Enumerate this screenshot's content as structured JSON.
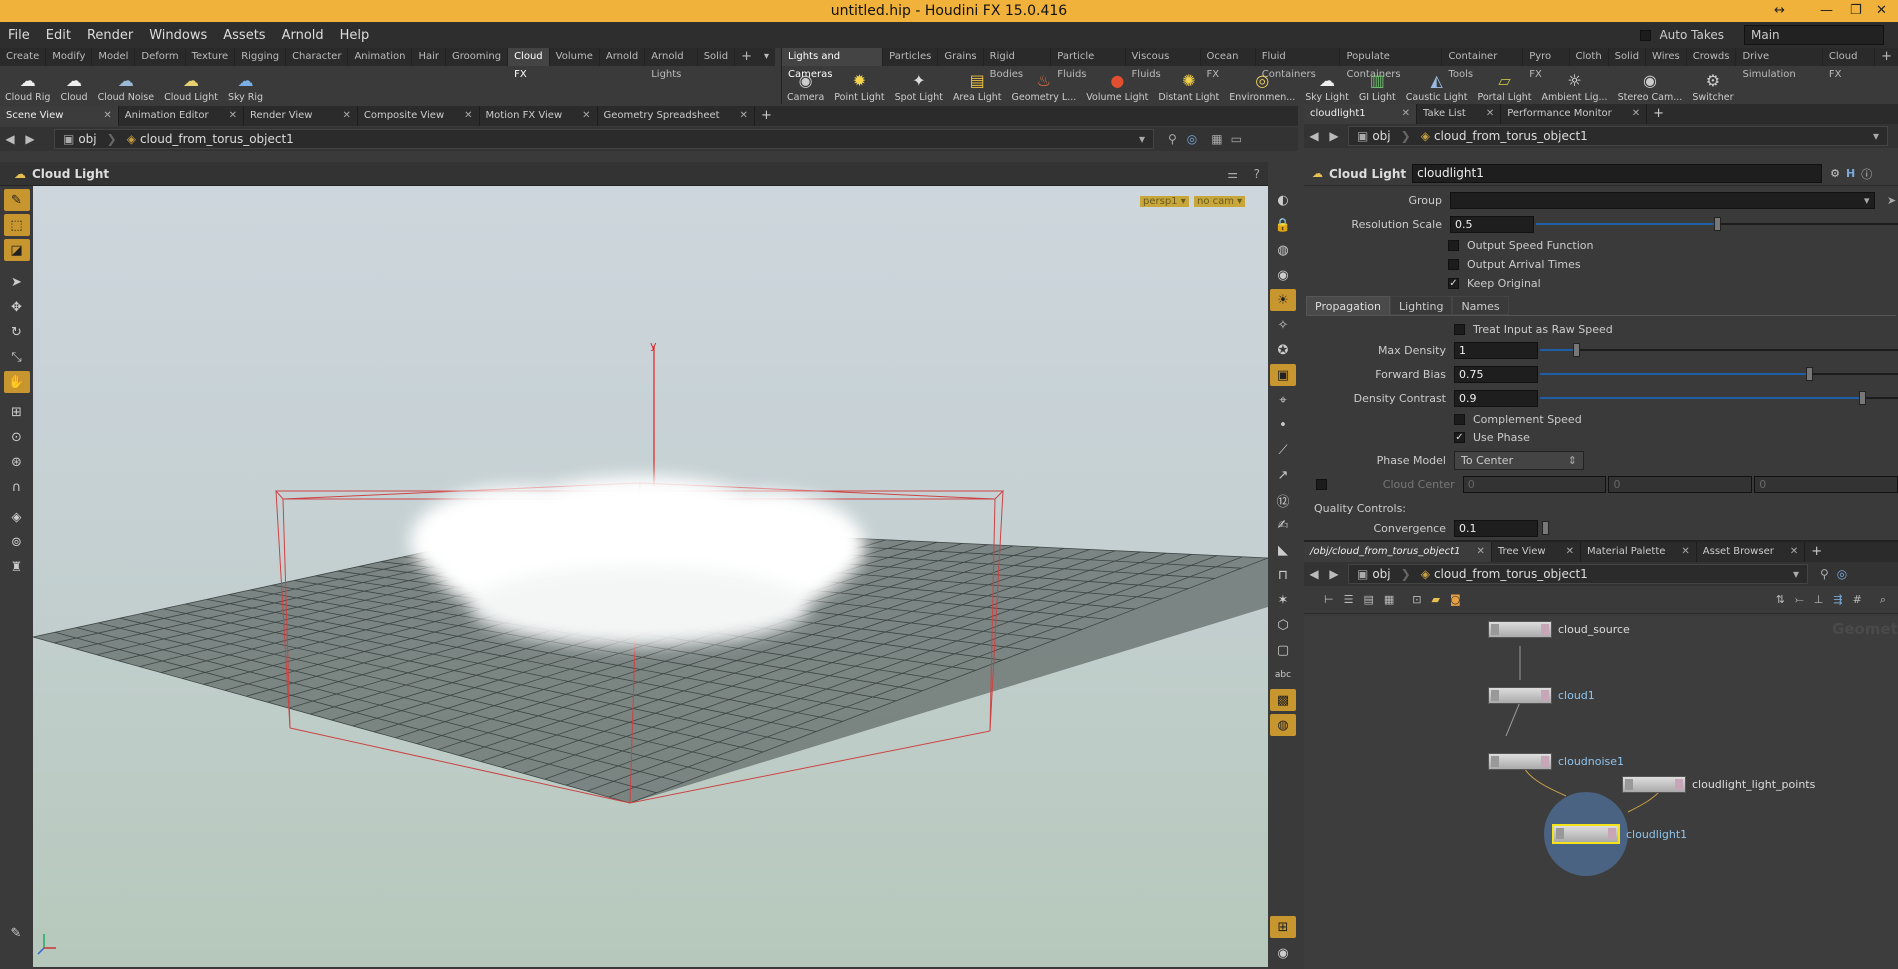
{
  "window": {
    "title": "untitled.hip - Houdini FX 15.0.416"
  },
  "menu": {
    "items": [
      "File",
      "Edit",
      "Render",
      "Windows",
      "Assets",
      "Arnold",
      "Help"
    ],
    "auto_takes": "Auto Takes",
    "desktop": "Main"
  },
  "shelf_left": {
    "tabs": [
      "Create",
      "Modify",
      "Model",
      "Deform",
      "Texture",
      "Rigging",
      "Character",
      "Animation",
      "Hair",
      "Grooming",
      "Cloud FX",
      "Volume",
      "Arnold",
      "Arnold Lights",
      "Solid"
    ],
    "active": "Cloud FX",
    "tools": [
      "Cloud Rig",
      "Cloud",
      "Cloud Noise",
      "Cloud Light",
      "Sky Rig"
    ]
  },
  "shelf_right": {
    "tabs": [
      "Lights and Cameras",
      "Particles",
      "Grains",
      "Rigid Bodies",
      "Particle Fluids",
      "Viscous Fluids",
      "Ocean FX",
      "Fluid Containers",
      "Populate Containers",
      "Container Tools",
      "Pyro FX",
      "Cloth",
      "Solid",
      "Wires",
      "Crowds",
      "Drive Simulation",
      "Cloud FX"
    ],
    "tools": [
      "Camera",
      "Point Light",
      "Spot Light",
      "Area Light",
      "Geometry L...",
      "Volume Light",
      "Distant Light",
      "Environmen...",
      "Sky Light",
      "GI Light",
      "Caustic Light",
      "Portal Light",
      "Ambient Lig...",
      "Stereo Cam...",
      "Switcher"
    ]
  },
  "viewer": {
    "tabs": [
      "Scene View",
      "Animation Editor",
      "Render View",
      "Composite View",
      "Motion FX View",
      "Geometry Spreadsheet"
    ],
    "path_root": "obj",
    "path_object": "cloud_from_torus_object1",
    "tool_title": "Cloud Light",
    "cam_persp": "persp1 ▾",
    "cam_nocam": "no cam ▾",
    "axis_y": "y"
  },
  "params": {
    "tabs": [
      "cloudlight1",
      "Take List",
      "Performance Monitor"
    ],
    "path_root": "obj",
    "path_object": "cloud_from_torus_object1",
    "node_type": "Cloud Light",
    "node_name": "cloudlight1",
    "group_label": "Group",
    "group_value": "",
    "resolution_scale_label": "Resolution Scale",
    "resolution_scale": "0.5",
    "resolution_scale_frac": 0.5,
    "output_speed": "Output Speed Function",
    "output_arrival": "Output Arrival Times",
    "keep_original": "Keep Original",
    "subtabs": [
      "Propagation",
      "Lighting",
      "Names"
    ],
    "treat_input": "Treat Input as Raw Speed",
    "max_density_label": "Max Density",
    "max_density": "1",
    "max_density_frac": 0.1,
    "forward_bias_label": "Forward Bias",
    "forward_bias": "0.75",
    "forward_bias_frac": 0.75,
    "density_contrast_label": "Density Contrast",
    "density_contrast": "0.9",
    "density_contrast_frac": 0.9,
    "complement_speed": "Complement Speed",
    "use_phase": "Use Phase",
    "phase_model_label": "Phase Model",
    "phase_model": "To Center",
    "cloud_center_label": "Cloud Center",
    "cloud_center": [
      "0",
      "0",
      "0"
    ],
    "quality_controls": "Quality Controls:",
    "convergence_label": "Convergence",
    "convergence": "0.1"
  },
  "network": {
    "tabs": [
      "/obj/cloud_from_torus_object1",
      "Tree View",
      "Material Palette",
      "Asset Browser"
    ],
    "path_root": "obj",
    "path_object": "cloud_from_torus_object1",
    "watermark": "Geometr",
    "nodes": [
      "cloud_source",
      "cloud1",
      "cloudnoise1",
      "cloudlight_light_points",
      "cloudlight1"
    ]
  }
}
